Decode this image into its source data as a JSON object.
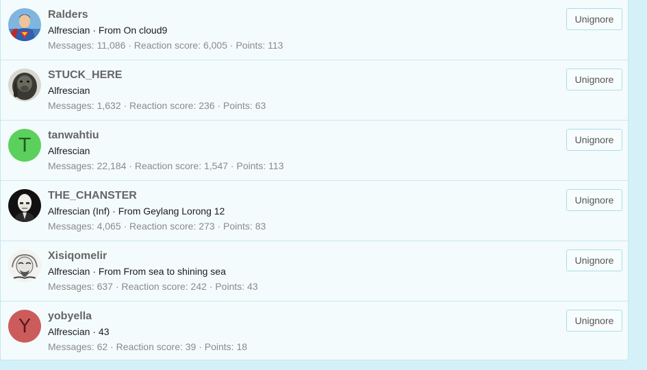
{
  "members": [
    {
      "name": "Ralders",
      "title": "Alfrescian · From On cloud9",
      "stats": "Messages: 11,086 · Reaction score: 6,005 · Points: 113",
      "avatar": {
        "type": "image",
        "icon": "superhero-avatar-icon"
      },
      "button": "Unignore"
    },
    {
      "name": "STUCK_HERE",
      "title": "Alfrescian",
      "stats": "Messages: 1,632 · Reaction score: 236 · Points: 63",
      "avatar": {
        "type": "image",
        "icon": "gorilla-avatar-icon"
      },
      "button": "Unignore"
    },
    {
      "name": "tanwahtiu",
      "title": "Alfrescian",
      "stats": "Messages: 22,184 · Reaction score: 1,547 · Points: 113",
      "avatar": {
        "type": "letter",
        "letter": "T",
        "bg": "#5cd05c",
        "fg": "#1f5e1f"
      },
      "button": "Unignore"
    },
    {
      "name": "THE_CHANSTER",
      "title": "Alfrescian (Inf) · From Geylang Lorong 12",
      "stats": "Messages: 4,065 · Reaction score: 273 · Points: 83",
      "avatar": {
        "type": "image",
        "icon": "bald-man-avatar-icon"
      },
      "button": "Unignore"
    },
    {
      "name": "Xisiqomelir",
      "title": "Alfrescian · From From sea to shining sea",
      "stats": "Messages: 637 · Reaction score: 242 · Points: 43",
      "avatar": {
        "type": "image",
        "icon": "sketch-portrait-avatar-icon"
      },
      "button": "Unignore"
    },
    {
      "name": "yobyella",
      "title": "Alfrescian · 43",
      "stats": "Messages: 62 · Reaction score: 39 · Points: 18",
      "avatar": {
        "type": "letter",
        "letter": "Y",
        "bg": "#cc5c5c",
        "fg": "#5a1b1b"
      },
      "button": "Unignore"
    }
  ]
}
